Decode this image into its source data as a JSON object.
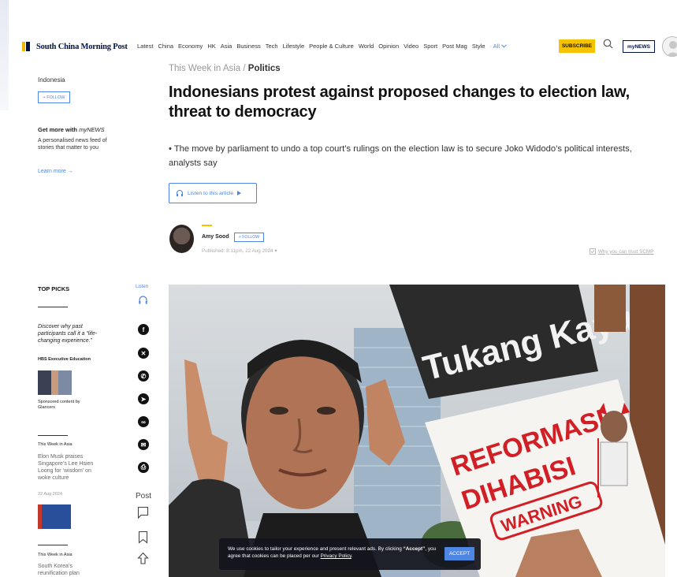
{
  "header": {
    "logo_text": "South China Morning Post",
    "nav": [
      "Latest",
      "China",
      "Economy",
      "HK",
      "Asia",
      "Business",
      "Tech",
      "Lifestyle",
      "People & Culture",
      "World",
      "Opinion",
      "Video",
      "Sport",
      "Post Mag",
      "Style"
    ],
    "nav_all": "All",
    "subscribe_label": "SUBSCRIBE",
    "mynews_label": "myNEWS",
    "accent_color": "#f5c300",
    "brand_color": "#001246",
    "link_color": "#4e86e4"
  },
  "sidebar": {
    "topic": "Indonesia",
    "follow_label": "+ FOLLOW",
    "promo_title_prefix": "Get more with ",
    "promo_title_brand": "myNEWS",
    "promo_text": "A personalised news feed of stories that matter to you",
    "learn_more": "Learn more →"
  },
  "article": {
    "breadcrumb_section": "This Week in Asia",
    "breadcrumb_sep": " / ",
    "breadcrumb_topic": "Politics",
    "headline": "Indonesians protest against proposed changes to election law, threat to democracy",
    "summary": "The move by parliament to undo a top court’s rulings on the election law is to secure Joko Widodo’s political interests, analysts say",
    "listen_label": "Listen to this article",
    "author": "Amy Sood",
    "author_follow": "+ FOLLOW",
    "published": "Published: 8:11pm, 22 Aug 2024",
    "trust_link": "Why you can trust SCMP"
  },
  "top_picks": {
    "title": "TOP PICKS",
    "sponsor_text": "Discover why past participants call it a “life-changing experience.”",
    "sponsor_name": "HBS Executive Education",
    "sponsored_label": "Sponsored content by",
    "sponsored_by": "Glancers",
    "story1_section": "This Week in Asia",
    "story1_title": "Elon Musk praises Singapore’s Lee Hsien Loong for ‘wisdom’ on woke culture",
    "story1_date": "22 Aug 2024",
    "story2_section": "This Week in Asia",
    "story2_title": "South Korea’s reunification plan"
  },
  "share": {
    "listen_label": "Listen",
    "post_label": "Post",
    "icons": [
      "facebook-icon",
      "x-icon",
      "whatsapp-icon",
      "telegram-icon",
      "link-icon",
      "email-icon",
      "print-icon"
    ]
  },
  "hero": {
    "sign_text_1": "Tukang Kayu",
    "sign_text_2a": "REFORMASI",
    "sign_text_2b": "DIHABISI",
    "sign_warning": "WARNING"
  },
  "cookie": {
    "text_1": "We use cookies to tailor your experience and present relevant ads. By clicking ",
    "text_accept": "“Accept”",
    "text_2": ", you agree that cookies can be placed per our ",
    "privacy_link": "Privacy Policy",
    "text_end": ".",
    "accept_label": "ACCEPT"
  }
}
